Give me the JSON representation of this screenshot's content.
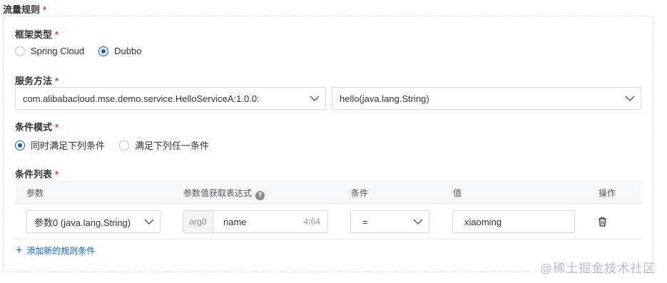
{
  "form": {
    "section_title": "流量规则",
    "required_mark": "*",
    "framework": {
      "label": "框架类型",
      "options": [
        {
          "label": "Spring Cloud",
          "selected": false
        },
        {
          "label": "Dubbo",
          "selected": true
        }
      ]
    },
    "service_method": {
      "label": "服务方法",
      "service_value": "com.alibabacloud.mse.demo.service.HelloServiceA:1.0.0:",
      "method_value": "hello(java.lang.String)"
    },
    "condition_mode": {
      "label": "条件模式",
      "options": [
        {
          "label": "同时满足下列条件",
          "selected": true
        },
        {
          "label": "满足下列任一条件",
          "selected": false
        }
      ]
    },
    "condition_list": {
      "label": "条件列表",
      "columns": [
        "参数",
        "参数值获取表达式",
        "条件",
        "值",
        "操作"
      ],
      "rows": [
        {
          "param": "参数0 (java.lang.String)",
          "expr_prefix": "arg0",
          "expr_value": "name",
          "expr_counter": "4/64",
          "condition": "=",
          "value": "xiaoming"
        }
      ],
      "add_label": "添加新的规则条件"
    }
  },
  "watermark": "@稀土掘金技术社区",
  "colors": {
    "accent": "#0b63d6",
    "required": "#e4393c",
    "border": "#d6d9de"
  }
}
